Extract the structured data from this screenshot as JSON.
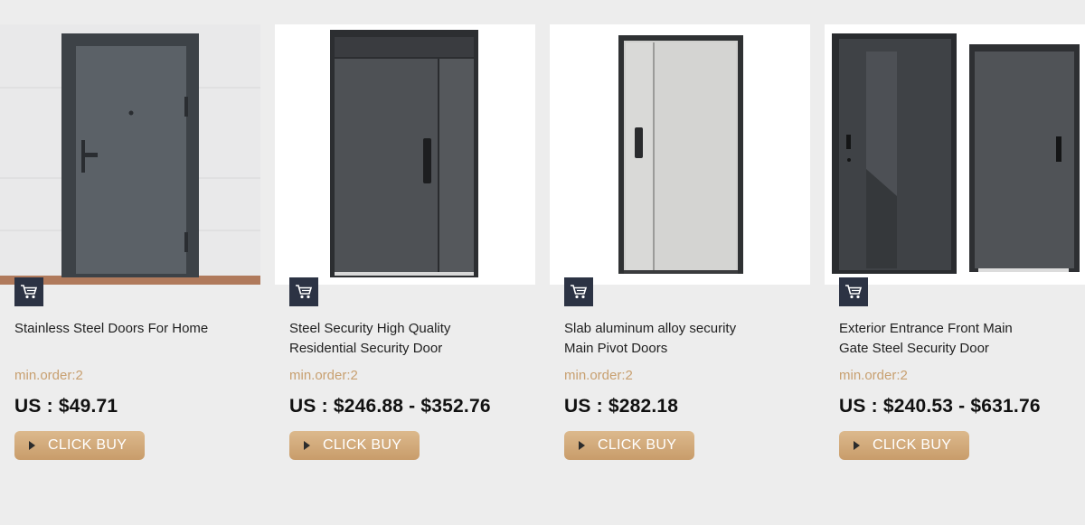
{
  "products": [
    {
      "title_line1": "Stainless Steel Doors For Home",
      "title_line2": "",
      "min_order": "min.order:2",
      "price": "US : $49.71",
      "button": "CLICK BUY",
      "image_icon": "gray-steel-door-image"
    },
    {
      "title_line1": "Steel Security High Quality",
      "title_line2": "Residential Security Door",
      "min_order": "min.order:2",
      "price": "US : $246.88 - $352.76",
      "button": "CLICK BUY",
      "image_icon": "dark-steel-door-image"
    },
    {
      "title_line1": "Slab aluminum alloy security",
      "title_line2": "Main Pivot Doors",
      "min_order": "min.order:2",
      "price": "US : $282.18",
      "button": "CLICK BUY",
      "image_icon": "light-aluminum-door-image"
    },
    {
      "title_line1": "Exterior Entrance Front Main",
      "title_line2": "Gate Steel Security Door",
      "min_order": "min.order:2",
      "price": "US : $240.53 - $631.76",
      "button": "CLICK BUY",
      "image_icon": "two-steel-doors-image"
    }
  ],
  "colors": {
    "background": "#ededed",
    "cart_badge": "#2c3344",
    "min_order_text": "#c8a070",
    "button_gold": "#d2aa7a"
  }
}
